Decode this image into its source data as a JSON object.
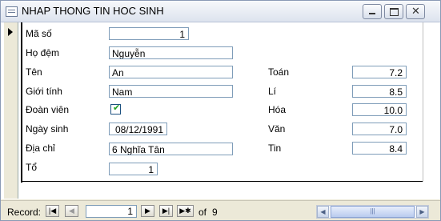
{
  "window": {
    "title": "NHAP THONG TIN HOC SINH"
  },
  "form": {
    "ma_so": {
      "label": "Mã số",
      "value": "1"
    },
    "ho_dem": {
      "label": "Họ đệm",
      "value": "Nguyễn"
    },
    "ten": {
      "label": "Tên",
      "value": "An"
    },
    "gioi_tinh": {
      "label": "Giới tính",
      "value": "Nam"
    },
    "doan_vien": {
      "label": "Đoàn viên",
      "checked": true
    },
    "ngay_sinh": {
      "label": "Ngày sinh",
      "value": "08/12/1991"
    },
    "dia_chi": {
      "label": "Địa chỉ",
      "value": "6 Nghĩa Tân"
    },
    "to": {
      "label": "Tổ",
      "value": "1"
    },
    "toan": {
      "label": "Toán",
      "value": "7.2"
    },
    "li": {
      "label": "Lí",
      "value": "8.5"
    },
    "hoa": {
      "label": "Hóa",
      "value": "10.0"
    },
    "van": {
      "label": "Văn",
      "value": "7.0"
    },
    "tin": {
      "label": "Tin",
      "value": "8.4"
    }
  },
  "navigation": {
    "label": "Record:",
    "current": "1",
    "of_text": "of",
    "total": "9"
  },
  "icons": {
    "window": "form-icon",
    "minimize": "minimize-icon",
    "maximize": "maximize-icon",
    "close": "close-icon",
    "first": "first-record-icon",
    "prev": "previous-record-icon",
    "next": "next-record-icon",
    "last": "last-record-icon",
    "new": "new-record-icon"
  }
}
